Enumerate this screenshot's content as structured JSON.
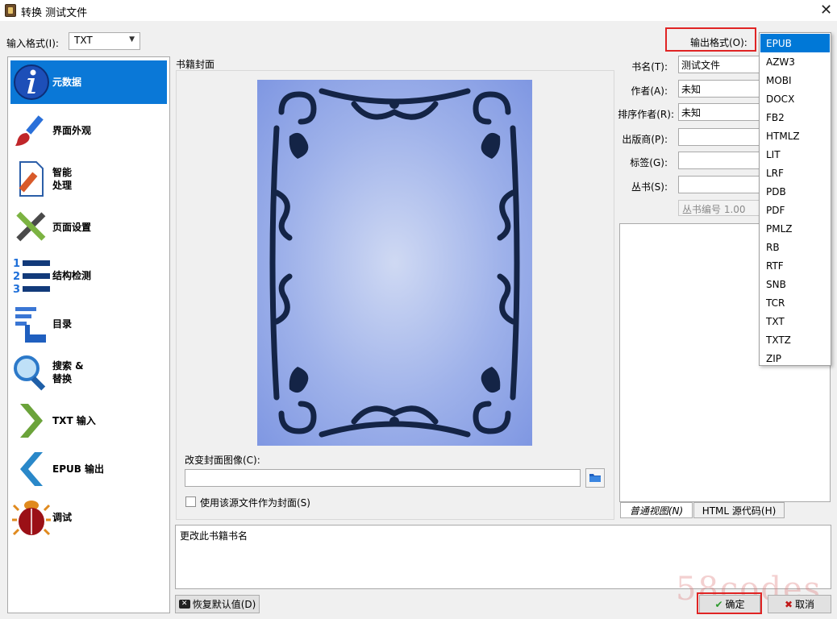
{
  "window": {
    "title": "转换 测试文件"
  },
  "input_format": {
    "label": "输入格式(I):",
    "value": "TXT"
  },
  "output_format": {
    "label": "输出格式(O):"
  },
  "sidebar": {
    "items": [
      {
        "label": "元数据",
        "icon": "info-icon",
        "active": true
      },
      {
        "label": "界面外观",
        "icon": "brush-icon"
      },
      {
        "label": "智能\n处理",
        "icon": "document-pen-icon"
      },
      {
        "label": "页面设置",
        "icon": "tools-icon"
      },
      {
        "label": "结构检测",
        "icon": "numbered-list-icon"
      },
      {
        "label": "目录",
        "icon": "toc-icon"
      },
      {
        "label": "搜索 &\n替换",
        "icon": "magnifier-icon"
      },
      {
        "label": "TXT 输入",
        "icon": "arrow-right-icon"
      },
      {
        "label": "EPUB 输出",
        "icon": "arrow-left-icon"
      },
      {
        "label": "调试",
        "icon": "bug-icon"
      }
    ]
  },
  "cover": {
    "group_title": "书籍封面",
    "change_label": "改变封面图像(C):",
    "path_value": "",
    "use_source_label": "使用该源文件作为封面(S)"
  },
  "metadata": {
    "title_label": "书名(T):",
    "title_value": "测试文件",
    "author_label": "作者(A):",
    "author_value": "未知",
    "sort_label": "排序作者(R):",
    "sort_value": "未知",
    "publisher_label": "出版商(P):",
    "publisher_value": "",
    "tags_label": "标签(G):",
    "tags_value": "",
    "series_label": "丛书(S):",
    "series_value": "",
    "series_number": "丛书编号 1.00"
  },
  "tabs": {
    "normal": "普通视图(N)",
    "html": "HTML 源代码(H)"
  },
  "description": {
    "text": "更改此书籍书名"
  },
  "buttons": {
    "restore": "恢复默认值(D)",
    "ok": "确定",
    "cancel": "取消"
  },
  "dropdown": {
    "selected": "EPUB",
    "options": [
      "EPUB",
      "AZW3",
      "MOBI",
      "DOCX",
      "FB2",
      "HTMLZ",
      "LIT",
      "LRF",
      "PDB",
      "PDF",
      "PMLZ",
      "RB",
      "RTF",
      "SNB",
      "TCR",
      "TXT",
      "TXTZ",
      "ZIP"
    ]
  },
  "watermark": "58codes"
}
